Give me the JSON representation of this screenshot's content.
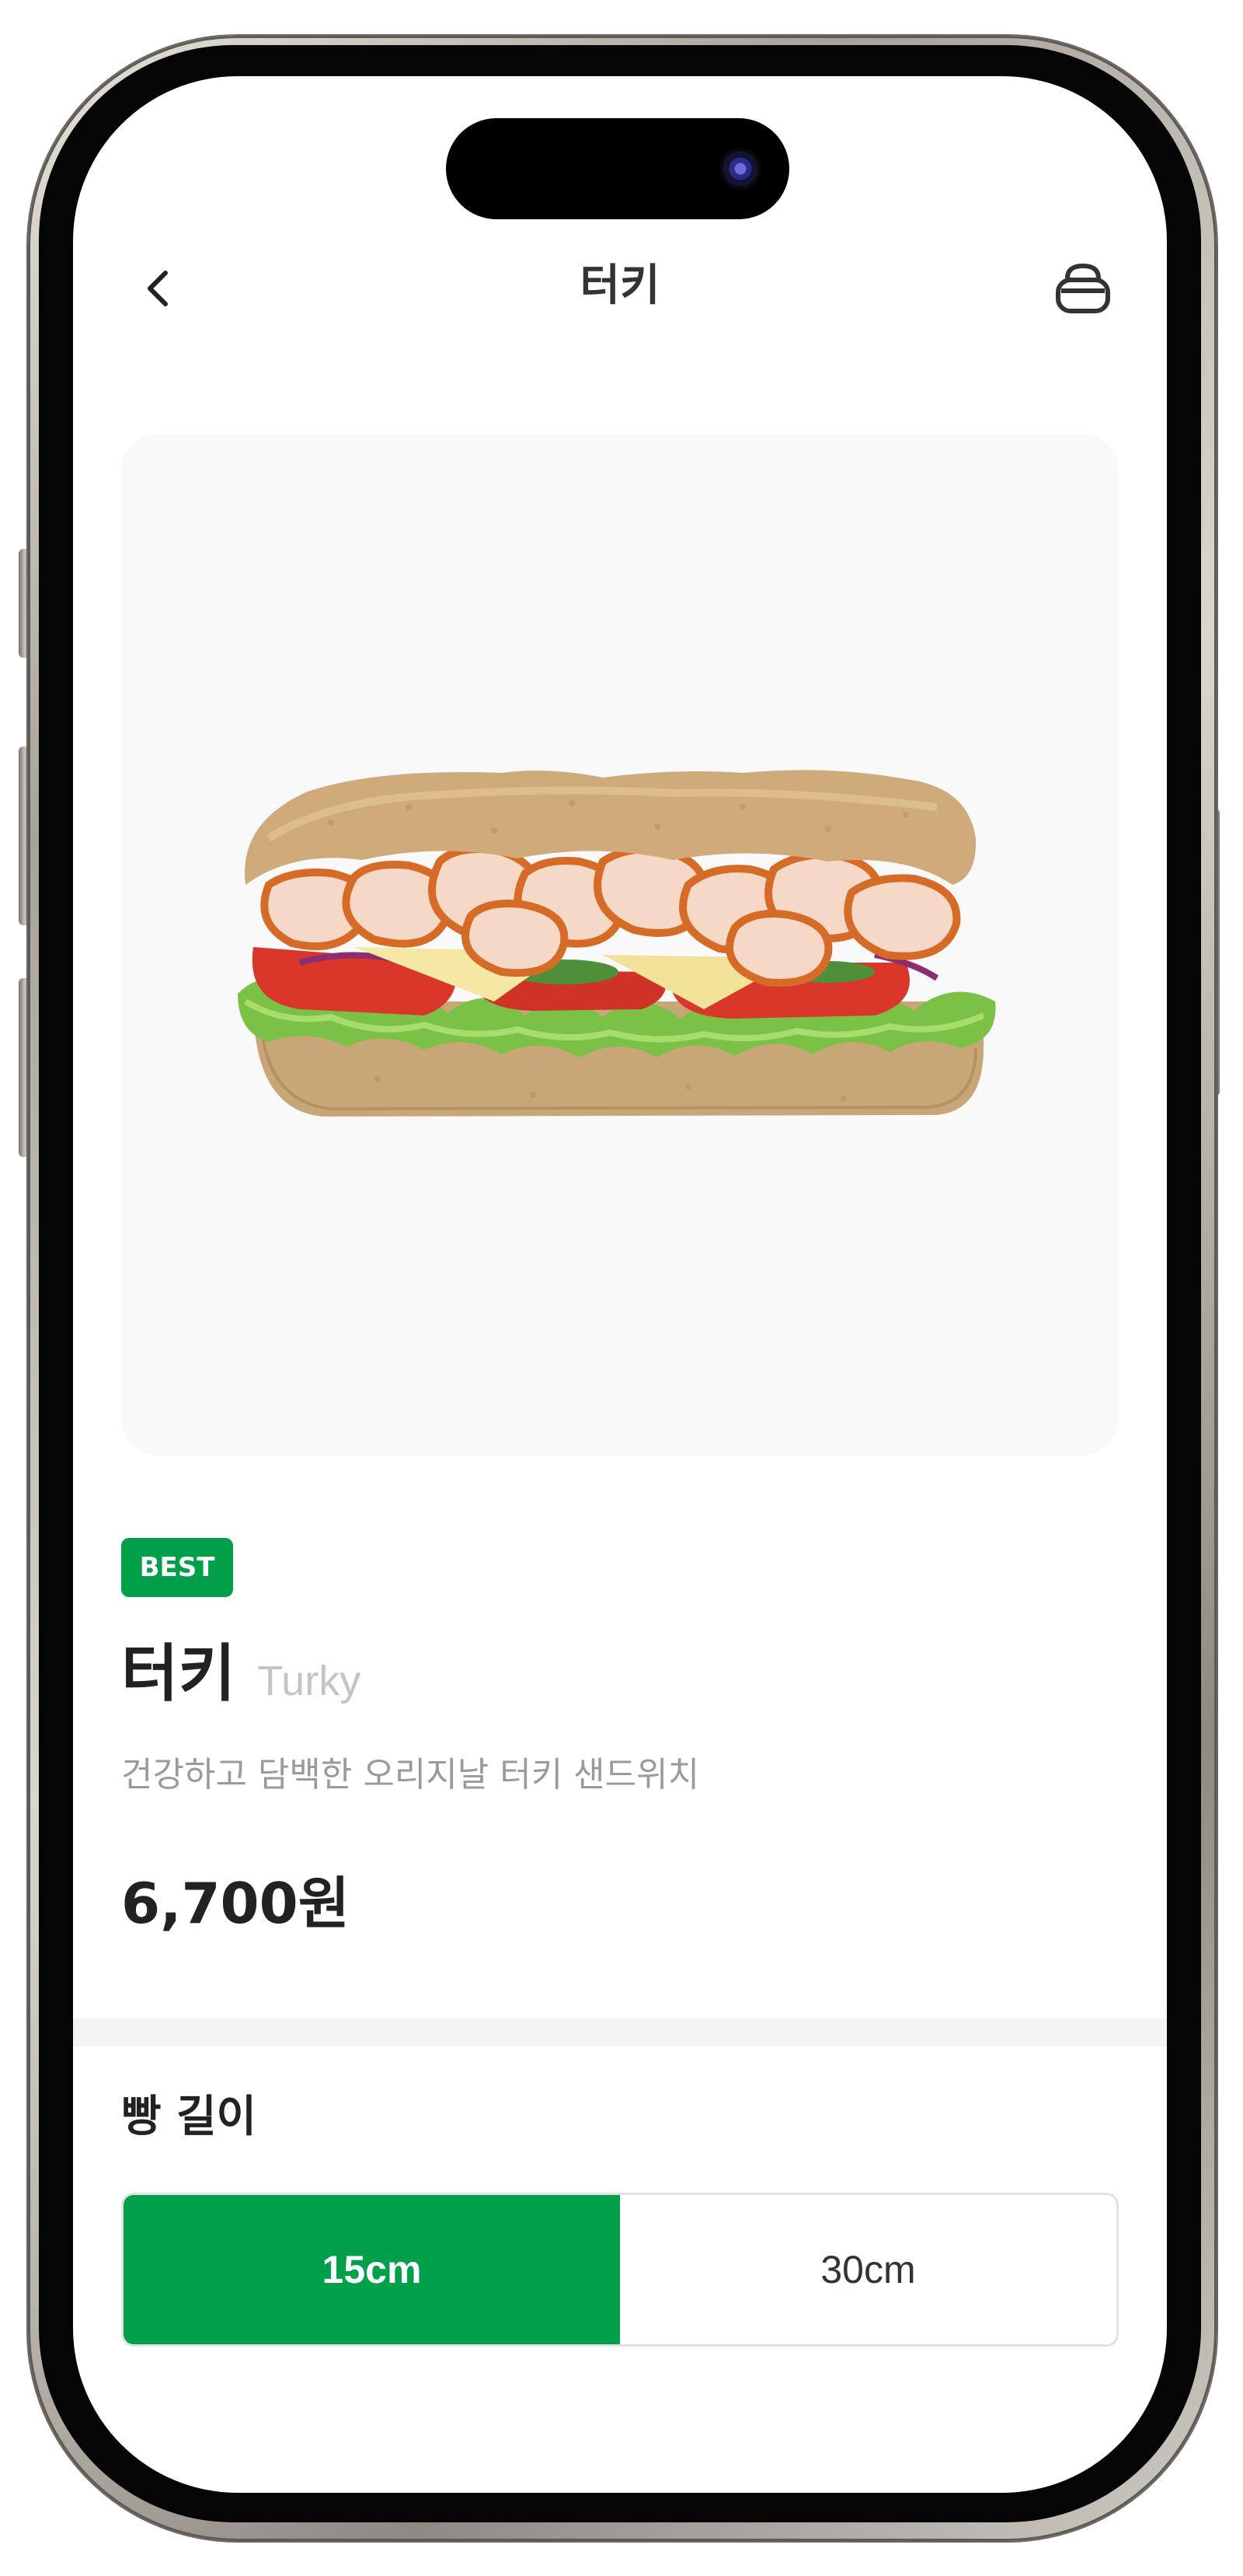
{
  "header": {
    "title": "터키",
    "back_icon": "chevron-left-icon",
    "cart_icon": "cart-bowl-icon"
  },
  "product": {
    "badge": "BEST",
    "name_ko": "터키",
    "name_en": "Turky",
    "description": "건강하고 담백한 오리지날 터키 샌드위치",
    "price": "6,700원",
    "image_icon": "sandwich-image"
  },
  "bread_length": {
    "title": "빵 길이",
    "options": [
      {
        "label": "15cm",
        "selected": true
      },
      {
        "label": "30cm",
        "selected": false
      }
    ]
  },
  "colors": {
    "accent": "#00a04b",
    "text_primary": "#222222",
    "text_secondary": "#9a9a9a",
    "card_bg": "#f9f9fa"
  }
}
